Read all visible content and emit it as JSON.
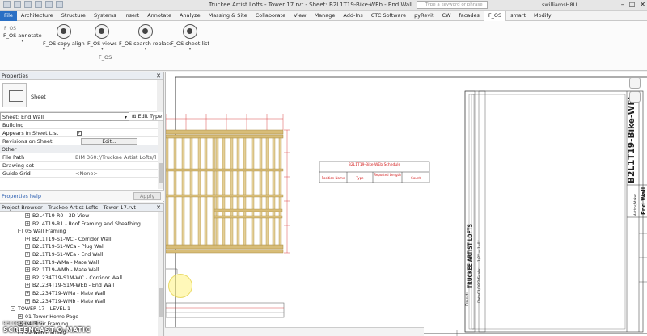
{
  "window": {
    "title": "Truckee Artist Lofts - Tower 17.rvt - Sheet: B2L1T19-Bike-WEb - End Wall",
    "search_placeholder": "Type a keyword or phrase",
    "user": "swilliamsH8U..."
  },
  "ribbon_tabs": [
    "File",
    "Architecture",
    "Structure",
    "Systems",
    "Insert",
    "Annotate",
    "Analyze",
    "Massing & Site",
    "Collaborate",
    "View",
    "Manage",
    "Add-Ins",
    "CTC Software",
    "pyRevit",
    "CW",
    "facades",
    "F_OS",
    "smart",
    "Modify"
  ],
  "active_tab": "F_OS",
  "ribbon": {
    "logo_text": "F_OS",
    "buttons": [
      "F_OS annotate",
      "F_OS copy align",
      "F_OS views",
      "F_OS search replace",
      "F_OS sheet list"
    ],
    "panel_label": "F_OS"
  },
  "properties": {
    "header": "Properties",
    "type_label": "Sheet",
    "selector": "Sheet: End Wall",
    "edit_type": "Edit Type",
    "rows": [
      {
        "key": "Building",
        "value": ""
      },
      {
        "key": "Appears In Sheet List",
        "value": "✓"
      },
      {
        "key": "Revisions on Sheet",
        "value": "Edit..."
      }
    ],
    "section_other": "Other",
    "other_rows": [
      {
        "key": "File Path",
        "value": "BIM 360://Truckee Artist Lofts/T..."
      },
      {
        "key": "Drawing set",
        "value": ""
      },
      {
        "key": "Guide Grid",
        "value": "<None>"
      }
    ],
    "help": "Properties help",
    "apply": "Apply"
  },
  "browser": {
    "header": "Project Browser - Truckee Artist Lofts - Tower 17.rvt",
    "items": [
      {
        "indent": 3,
        "pm": "+",
        "label": "B2L4T19-R0 - 3D View"
      },
      {
        "indent": 3,
        "pm": "+",
        "label": "B2L4T19-R1 - Roof Framing and Sheathing"
      },
      {
        "indent": 2,
        "pm": "-",
        "label": "05 Wall Framing"
      },
      {
        "indent": 3,
        "pm": "+",
        "label": "B2L1T19-S1-WC - Corridor Wall"
      },
      {
        "indent": 3,
        "pm": "+",
        "label": "B2L1T19-S1-WCa - Plug Wall"
      },
      {
        "indent": 3,
        "pm": "+",
        "label": "B2L1T19-S1-WEa - End Wall"
      },
      {
        "indent": 3,
        "pm": "+",
        "label": "B2L1T19-WMa - Mate Wall"
      },
      {
        "indent": 3,
        "pm": "+",
        "label": "B2L1T19-WMb - Mate Wall"
      },
      {
        "indent": 3,
        "pm": "+",
        "label": "B2L234T19-S1M-WC - Corridor Wall"
      },
      {
        "indent": 3,
        "pm": "+",
        "label": "B2L234T19-S1M-WEb - End Wall"
      },
      {
        "indent": 3,
        "pm": "+",
        "label": "B2L234T19-WMa - Mate Wall"
      },
      {
        "indent": 3,
        "pm": "+",
        "label": "B2L234T19-WMb - Mate Wall"
      },
      {
        "indent": 1,
        "pm": "-",
        "label": "TOWER 17 - LEVEL 1"
      },
      {
        "indent": 2,
        "pm": "+",
        "label": "01 Tower Home Page"
      },
      {
        "indent": 2,
        "pm": "+",
        "label": "04 Floor Framing"
      },
      {
        "indent": 2,
        "pm": "-",
        "label": "05 Wall Framing"
      }
    ]
  },
  "sheet": {
    "number": "B2L1T19-Bike-WEb",
    "name": "End Wall",
    "project_label": "Project:",
    "project": "TRUCKEE ARTIST LOFTS",
    "scale_label": "Scale:",
    "scale": "1/2\" = 1'-0\"",
    "date_label": "Date:",
    "date": "01/08/20",
    "author_label": "Author/Maker"
  },
  "schedule": {
    "title": "B2L1T19-Bike-WEb Schedule",
    "columns": [
      "Position Name",
      "Type",
      "Reported Length",
      "Count"
    ]
  },
  "watermark": {
    "top": "RECORDED WITH",
    "main": "SCREENCAST-O-MATIC"
  },
  "colors": {
    "file_tab": "#2a6fc4",
    "framing": "#c9a85a",
    "dimension": "#d42020"
  }
}
